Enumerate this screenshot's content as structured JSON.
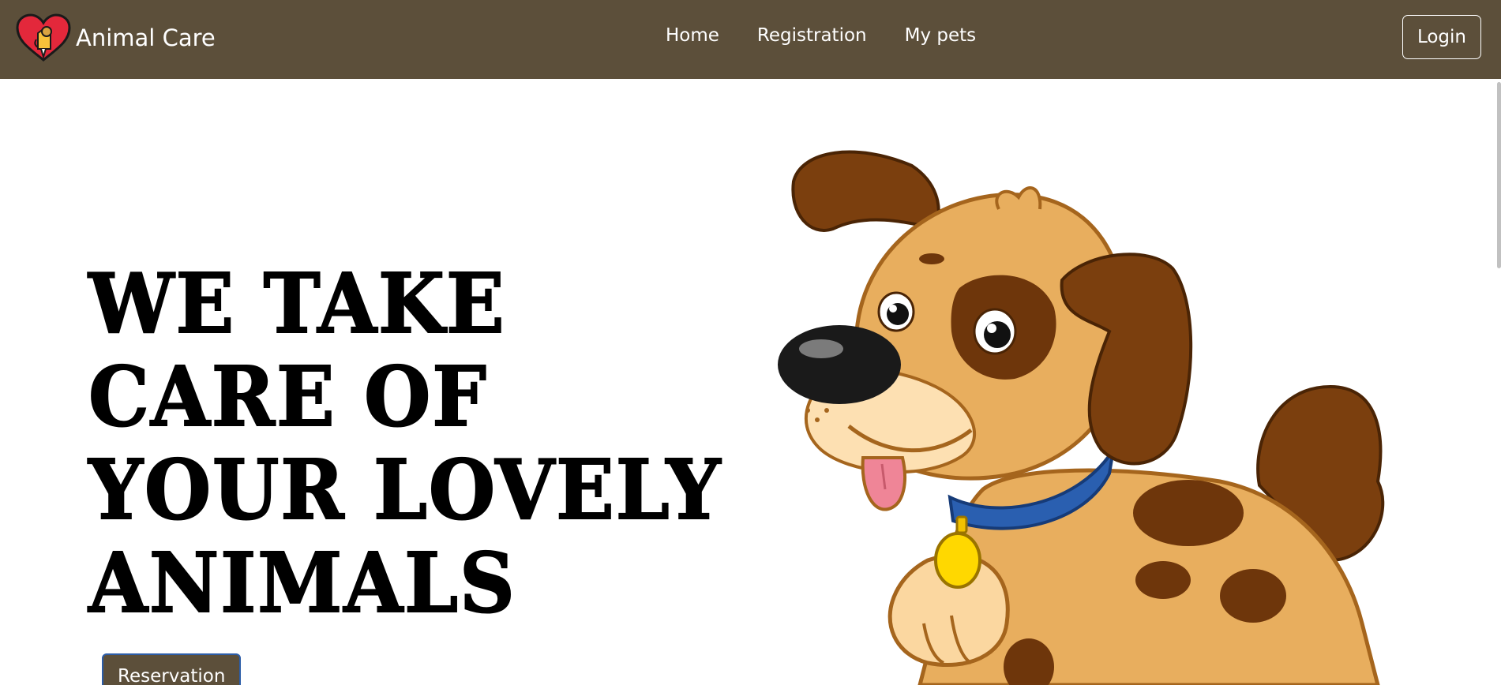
{
  "navbar": {
    "brand": "Animal Care",
    "links": [
      "Home",
      "Registration",
      "My pets"
    ],
    "login_label": "Login"
  },
  "hero": {
    "title_lines": [
      "WE TAKE",
      "CARE OF",
      "YOUR LOVELY",
      "ANIMALS"
    ],
    "button_label": "Reservation"
  },
  "illustration": {
    "subject": "cartoon-puppy",
    "icon": "dog-icon"
  },
  "colors": {
    "navbar": "#5c4f3a",
    "accent": "#2c5da8",
    "heart": "#e3283b",
    "text_light": "#ffffff"
  }
}
